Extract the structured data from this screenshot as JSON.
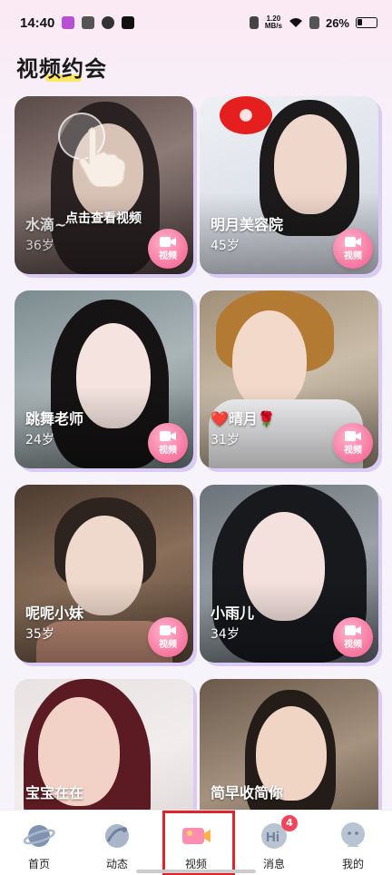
{
  "status_bar": {
    "time": "14:40",
    "speed_top": "1.20",
    "speed_bottom": "MB/s",
    "battery": "26%"
  },
  "page": {
    "title": "视频约会"
  },
  "hint": {
    "text": "点击查看视频"
  },
  "cards": [
    {
      "name": "水滴~",
      "age": "36岁",
      "badge": "视频"
    },
    {
      "name": "明月美容院",
      "age": "45岁",
      "badge": "视频"
    },
    {
      "name": "跳舞老师",
      "age": "24岁",
      "badge": "视频"
    },
    {
      "name": "❤️晴月🌹",
      "age": "31岁",
      "badge": "视频"
    },
    {
      "name": "呢呢小妹",
      "age": "35岁",
      "badge": "视频"
    },
    {
      "name": "小雨儿",
      "age": "34岁",
      "badge": "视频"
    },
    {
      "name": "宝宝在在",
      "age": "",
      "badge": ""
    },
    {
      "name": "简早收简你",
      "age": "",
      "badge": ""
    }
  ],
  "nav": {
    "items": [
      {
        "label": "首页",
        "icon": "planet-icon"
      },
      {
        "label": "动态",
        "icon": "moments-icon"
      },
      {
        "label": "视频",
        "icon": "video-icon"
      },
      {
        "label": "消息",
        "icon": "hi-message-icon"
      },
      {
        "label": "我的",
        "icon": "profile-icon"
      }
    ],
    "message_badge": "4",
    "active": "视频"
  },
  "colors": {
    "accent_pink": "#f7759e",
    "highlight_red": "#e0242b",
    "card_shadow": "#d9cbf3"
  }
}
